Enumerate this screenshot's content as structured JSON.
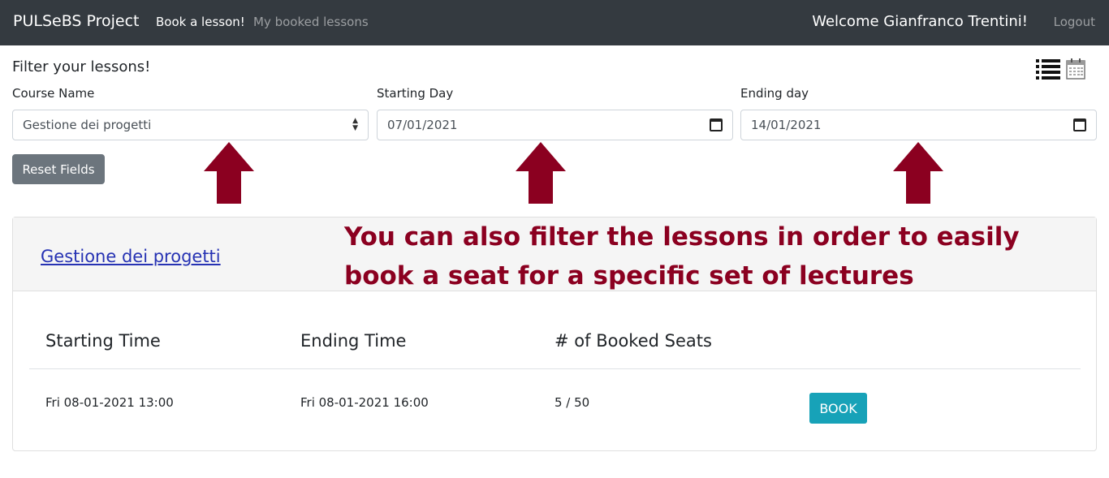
{
  "navbar": {
    "brand": "PULSeBS Project",
    "links": [
      {
        "label": "Book a lesson!",
        "active": true
      },
      {
        "label": "My booked lessons",
        "active": false
      }
    ],
    "welcome": "Welcome Gianfranco Trentini!",
    "logout": "Logout"
  },
  "filter": {
    "title": "Filter your lessons!",
    "course_label": "Course Name",
    "course_value": "Gestione dei progetti",
    "start_label": "Starting Day",
    "start_value": "07/01/2021",
    "end_label": "Ending day",
    "end_value": "14/01/2021",
    "reset_label": "Reset Fields",
    "view_icons": [
      "list-view-icon",
      "calendar-view-icon"
    ]
  },
  "annotation": {
    "text": "You can also filter the lessons in order to easily book a seat for a specific set of lectures",
    "color": "#8b0020"
  },
  "course_card": {
    "title": "Gestione dei progetti",
    "columns": [
      "Starting Time",
      "Ending Time",
      "# of Booked Seats"
    ],
    "rows": [
      {
        "start": "Fri 08-01-2021 13:00",
        "end": "Fri 08-01-2021 16:00",
        "seats": "5 / 50",
        "action": "BOOK"
      }
    ]
  },
  "colors": {
    "navbar_bg": "#343a40",
    "reset_button": "#6c757d",
    "book_button": "#17a2b8",
    "link": "#2632b3"
  }
}
